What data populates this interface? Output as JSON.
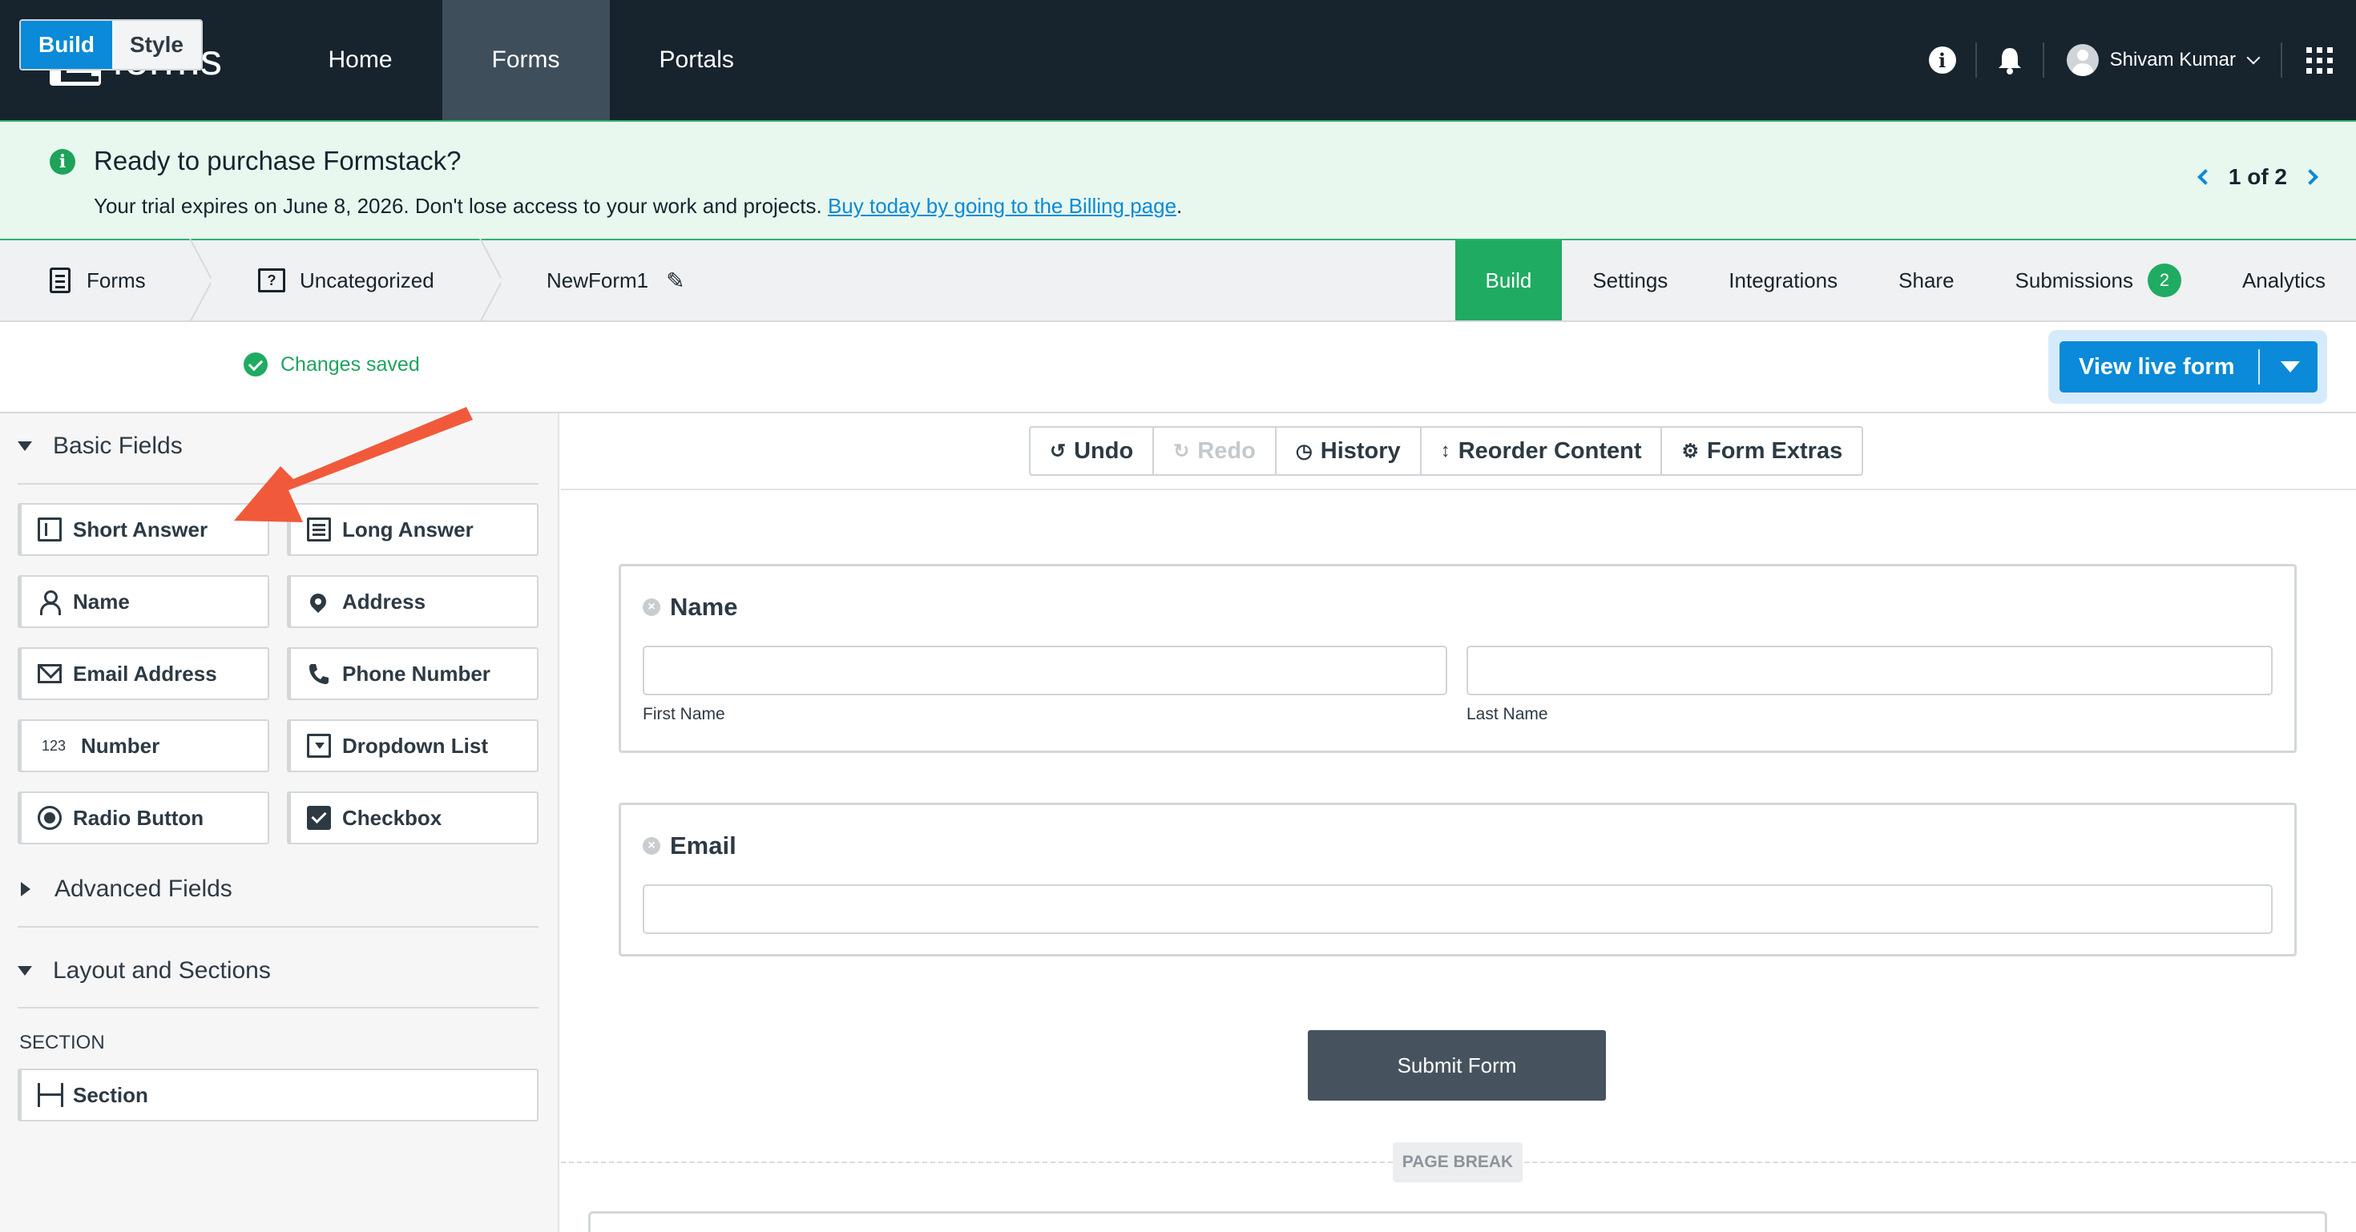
{
  "topnav": {
    "logo_text": "forms",
    "links": [
      "Home",
      "Forms",
      "Portals"
    ],
    "active_link": "Forms",
    "user_name": "Shivam Kumar",
    "icons": [
      "info-icon",
      "bell-icon",
      "user-avatar",
      "apps-grid-icon"
    ]
  },
  "banner": {
    "title": "Ready to purchase Formstack?",
    "text": "Your trial expires on June 8, 2026. Don't lose access to your work and projects. ",
    "link_text": "Buy today by going to the Billing page",
    "text_end": ".",
    "pager": "1 of 2",
    "accent": "#2fb36b"
  },
  "breadcrumb": {
    "items": [
      "Forms",
      "Uncategorized",
      "NewForm1"
    ]
  },
  "tabs": {
    "items": [
      "Build",
      "Settings",
      "Integrations",
      "Share",
      "Submissions",
      "Analytics"
    ],
    "active": "Build",
    "submissions_count": "2"
  },
  "toolbar": {
    "build_label": "Build",
    "style_label": "Style",
    "saved_label": "Changes saved",
    "view_live_label": "View live form"
  },
  "sidebar": {
    "basic_fields_label": "Basic Fields",
    "basic_fields": [
      {
        "label": "Short Answer",
        "icon": "short-answer-icon"
      },
      {
        "label": "Long Answer",
        "icon": "long-answer-icon"
      },
      {
        "label": "Name",
        "icon": "person-icon"
      },
      {
        "label": "Address",
        "icon": "map-pin-icon"
      },
      {
        "label": "Email Address",
        "icon": "envelope-icon"
      },
      {
        "label": "Phone Number",
        "icon": "phone-icon"
      },
      {
        "label": "Number",
        "icon": "number-icon",
        "glyph": "123"
      },
      {
        "label": "Dropdown List",
        "icon": "dropdown-icon"
      },
      {
        "label": "Radio Button",
        "icon": "radio-icon"
      },
      {
        "label": "Checkbox",
        "icon": "checkbox-icon"
      }
    ],
    "advanced_fields_label": "Advanced Fields",
    "layout_label": "Layout and Sections",
    "section_heading": "SECTION",
    "section_field": "Section"
  },
  "canvas_toolbar": {
    "undo": "Undo",
    "redo": "Redo",
    "history": "History",
    "reorder": "Reorder Content",
    "extras": "Form Extras"
  },
  "form": {
    "name_field": {
      "title": "Name",
      "first_sub": "First Name",
      "last_sub": "Last Name"
    },
    "email_field": {
      "title": "Email"
    },
    "submit_label": "Submit Form",
    "page_break_label": "PAGE BREAK"
  },
  "colors": {
    "nav_bg": "#17232d",
    "primary_blue": "#0a8ad8",
    "green": "#1fab62",
    "annotation_arrow": "#f05a3a"
  }
}
